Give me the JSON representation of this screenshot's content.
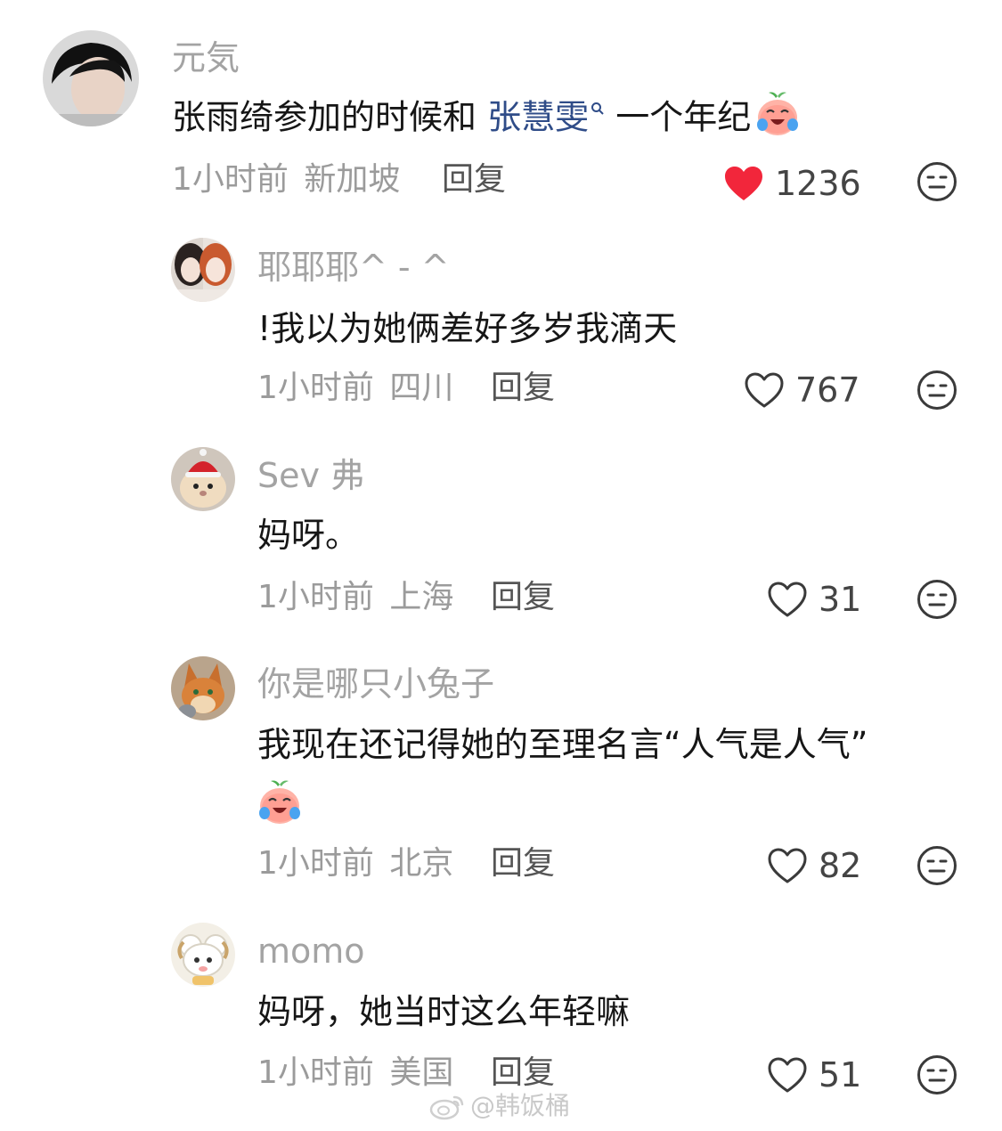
{
  "comments": [
    {
      "username": "元気",
      "text_before": "张雨绮参加的时候和 ",
      "mention": "张慧雯",
      "text_after": " 一个年纪",
      "time": "1小时前",
      "location": "新加坡",
      "reply_label": "回复",
      "likes": "1236",
      "liked": true
    },
    {
      "username": "耶耶耶^ - ^",
      "text": "!我以为她俩差好多岁我滴天",
      "time": "1小时前",
      "location": "四川",
      "reply_label": "回复",
      "likes": "767",
      "liked": false
    },
    {
      "username": "Sev 弗",
      "text": "妈呀。",
      "time": "1小时前",
      "location": "上海",
      "reply_label": "回复",
      "likes": "31",
      "liked": false
    },
    {
      "username": "你是哪只小兔子",
      "text": "我现在还记得她的至理名言“人气是人气”",
      "time": "1小时前",
      "location": "北京",
      "reply_label": "回复",
      "likes": "82",
      "liked": false
    },
    {
      "username": "momo",
      "text": "妈呀，她当时这么年轻嘛",
      "time": "1小时前",
      "location": "美国",
      "reply_label": "回复",
      "likes": "51",
      "liked": false
    }
  ],
  "watermark": "@韩饭桶",
  "colors": {
    "liked_heart": "#f2263b",
    "mention": "#2f4c88",
    "username": "#a3a3a3",
    "meta": "#9b9b9b"
  },
  "icons": {
    "like": "heart-icon",
    "dislike": "unhappy-face-icon",
    "emoji": "crying-laughing-peach-emoji",
    "mention_marker": "search-icon",
    "watermark_logo": "weibo-logo-icon"
  }
}
